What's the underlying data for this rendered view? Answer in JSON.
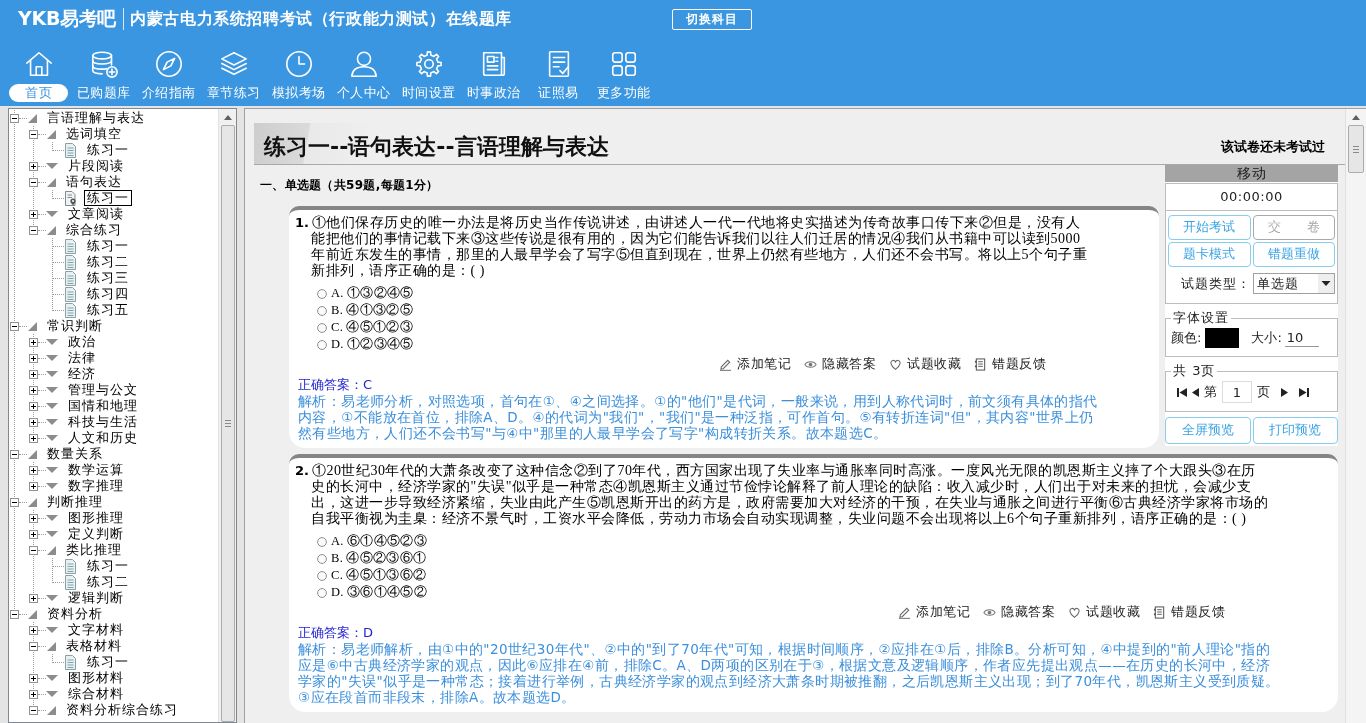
{
  "header": {
    "logo": "YKB易考吧",
    "title": "内蒙古电力系统招聘考试（行政能力测试）在线题库",
    "switch_button": "切换科目"
  },
  "toolbar": [
    {
      "label": "首页",
      "selected": true
    },
    {
      "label": "已购题库",
      "selected": false
    },
    {
      "label": "介绍指南",
      "selected": false
    },
    {
      "label": "章节练习",
      "selected": false
    },
    {
      "label": "模拟考场",
      "selected": false
    },
    {
      "label": "个人中心",
      "selected": false
    },
    {
      "label": "时间设置",
      "selected": false
    },
    {
      "label": "时事政治",
      "selected": false
    },
    {
      "label": "证照易",
      "selected": false
    },
    {
      "label": "更多功能",
      "selected": false
    }
  ],
  "tree": [
    {
      "kind": "folder",
      "label": "言语理解与表达",
      "expanded": true,
      "children": [
        {
          "kind": "folder",
          "label": "选词填空",
          "expanded": true,
          "children": [
            {
              "kind": "exercise",
              "label": "练习一",
              "selected": false
            }
          ]
        },
        {
          "kind": "folder",
          "label": "片段阅读",
          "expanded": false
        },
        {
          "kind": "folder",
          "label": "语句表达",
          "expanded": true,
          "children": [
            {
              "kind": "exercise",
              "label": "练习一",
              "selected": true
            }
          ]
        },
        {
          "kind": "folder",
          "label": "文章阅读",
          "expanded": false
        },
        {
          "kind": "folder",
          "label": "综合练习",
          "expanded": true,
          "children": [
            {
              "kind": "exercise",
              "label": "练习一",
              "selected": false
            },
            {
              "kind": "exercise",
              "label": "练习二",
              "selected": false
            },
            {
              "kind": "exercise",
              "label": "练习三",
              "selected": false
            },
            {
              "kind": "exercise",
              "label": "练习四",
              "selected": false
            },
            {
              "kind": "exercise",
              "label": "练习五",
              "selected": false
            }
          ]
        }
      ]
    },
    {
      "kind": "folder",
      "label": "常识判断",
      "expanded": true,
      "children": [
        {
          "kind": "folder",
          "label": "政治",
          "expanded": false
        },
        {
          "kind": "folder",
          "label": "法律",
          "expanded": false
        },
        {
          "kind": "folder",
          "label": "经济",
          "expanded": false
        },
        {
          "kind": "folder",
          "label": "管理与公文",
          "expanded": false
        },
        {
          "kind": "folder",
          "label": "国情和地理",
          "expanded": false
        },
        {
          "kind": "folder",
          "label": "科技与生活",
          "expanded": false
        },
        {
          "kind": "folder",
          "label": "人文和历史",
          "expanded": false
        }
      ]
    },
    {
      "kind": "folder",
      "label": "数量关系",
      "expanded": true,
      "children": [
        {
          "kind": "folder",
          "label": "数学运算",
          "expanded": false
        },
        {
          "kind": "folder",
          "label": "数字推理",
          "expanded": false
        }
      ]
    },
    {
      "kind": "folder",
      "label": "判断推理",
      "expanded": true,
      "children": [
        {
          "kind": "folder",
          "label": "图形推理",
          "expanded": false
        },
        {
          "kind": "folder",
          "label": "定义判断",
          "expanded": false
        },
        {
          "kind": "folder",
          "label": "类比推理",
          "expanded": true,
          "children": [
            {
              "kind": "exercise",
              "label": "练习一",
              "selected": false
            },
            {
              "kind": "exercise",
              "label": "练习二",
              "selected": false
            }
          ]
        },
        {
          "kind": "folder",
          "label": "逻辑判断",
          "expanded": false
        }
      ]
    },
    {
      "kind": "folder",
      "label": "资料分析",
      "expanded": true,
      "children": [
        {
          "kind": "folder",
          "label": "文字材料",
          "expanded": false
        },
        {
          "kind": "folder",
          "label": "表格材料",
          "expanded": true,
          "children": [
            {
              "kind": "exercise",
              "label": "练习一",
              "selected": false
            }
          ]
        },
        {
          "kind": "folder",
          "label": "图形材料",
          "expanded": false
        },
        {
          "kind": "folder",
          "label": "综合材料",
          "expanded": false
        },
        {
          "kind": "folder",
          "label": "资料分析综合练习",
          "expanded": true
        }
      ]
    }
  ],
  "exam": {
    "title": "练习一--语句表达--言语理解与表达",
    "status": "该试卷还未考试过",
    "section": "一、单选题（共59题,每题1分）",
    "questions": [
      {
        "number": "1.",
        "text": "①他们保存历史的唯一办法是将历史当作传说讲述，由讲述人一代一代地将史实描述为传奇故事口传下来②但是，没有人能把他们的事情记载下来③这些传说是很有用的，因为它们能告诉我们以往人们迁居的情况④我们从书籍中可以读到5000年前近东发生的事情，那里的人最早学会了写字⑤但直到现在，世界上仍然有些地方，人们还不会书写。将以上5个句子重新排列，语序正确的是：( )",
        "options": [
          {
            "label": "A. ①③②④⑤",
            "selected": false
          },
          {
            "label": "B. ④①③②⑤",
            "selected": false
          },
          {
            "label": "C. ④⑤①②③",
            "selected": false
          },
          {
            "label": "D. ①②③④⑤",
            "selected": false
          }
        ],
        "actions": [
          "添加笔记",
          "隐藏答案",
          "试题收藏",
          "错题反馈"
        ],
        "answer": "正确答案：C",
        "explanation": "解析：易老师分析，对照选项，首句在①、④之间选择。①的\"他们\"是代词，一般来说，用到人称代词时，前文须有具体的指代内容，①不能放在首位，排除A、D。④的代词为\"我们\"，\"我们\"是一种泛指，可作首句。⑤有转折连词\"但\"，其内容\"世界上仍然有些地方，人们还不会书写\"与④中\"那里的人最早学会了写字\"构成转折关系。故本题选C。"
      },
      {
        "number": "2.",
        "text": "①20世纪30年代的大萧条改变了这种信念②到了70年代，西方国家出现了失业率与通胀率同时高涨。一度风光无限的凯恩斯主义摔了个大跟头③在历史的长河中，经济学家的\"失误\"似乎是一种常态④凯恩斯主义通过节俭悖论解释了前人理论的缺陷：收入减少时，人们出于对未来的担忧，会减少支出，这进一步导致经济紧缩，失业由此产生⑤凯恩斯开出的药方是，政府需要加大对经济的干预，在失业与通胀之间进行平衡⑥古典经济学家将市场的自我平衡视为圭臬：经济不景气时，工资水平会降低，劳动力市场会自动实现调整，失业问题不会出现将以上6个句子重新排列，语序正确的是：( )",
        "options": [
          {
            "label": "A. ⑥①④⑤②③",
            "selected": false
          },
          {
            "label": "B. ④⑤②③⑥①",
            "selected": false
          },
          {
            "label": "C. ④⑤①③⑥②",
            "selected": false
          },
          {
            "label": "D. ③⑥①④⑤②",
            "selected": false
          }
        ],
        "actions": [
          "添加笔记",
          "隐藏答案",
          "试题收藏",
          "错题反馈"
        ],
        "answer": "正确答案：D",
        "explanation": "解析：易老师解析，由①中的\"20世纪30年代\"、②中的\"到了70年代\"可知，根据时间顺序，②应排在①后，排除B。分析可知，④中提到的\"前人理论\"指的应是⑥中古典经济学家的观点，因此⑥应排在④前，排除C。A、D两项的区别在于③，根据文意及逻辑顺序，作者应先提出观点——在历史的长河中，经济学家的\"失误\"似乎是一种常态；接着进行举例，古典经济学家的观点到经济大萧条时期被推翻，之后凯恩斯主义出现；到了70年代，凯恩斯主义受到质疑。③应在段首而非段末，排除A。故本题选D。"
      }
    ]
  },
  "control_panel": {
    "title": "移动",
    "timer": "00:00:00",
    "buttons": [
      {
        "label": "开始考试",
        "disabled": false
      },
      {
        "label": "交　　卷",
        "disabled": true
      },
      {
        "label": "题卡模式",
        "disabled": false
      },
      {
        "label": "错题重做",
        "disabled": false
      }
    ],
    "type_label": "试题类型：",
    "type_value": "单选题",
    "font_settings": {
      "legend": "字体设置",
      "color_label": "颜色:",
      "color": "#000000",
      "size_label": "大小:",
      "size": "10"
    },
    "pager": {
      "legend": "共 3页",
      "prefix": "第",
      "page": "1",
      "suffix": "页"
    },
    "preview_buttons": [
      "全屏预览",
      "打印预览"
    ]
  }
}
